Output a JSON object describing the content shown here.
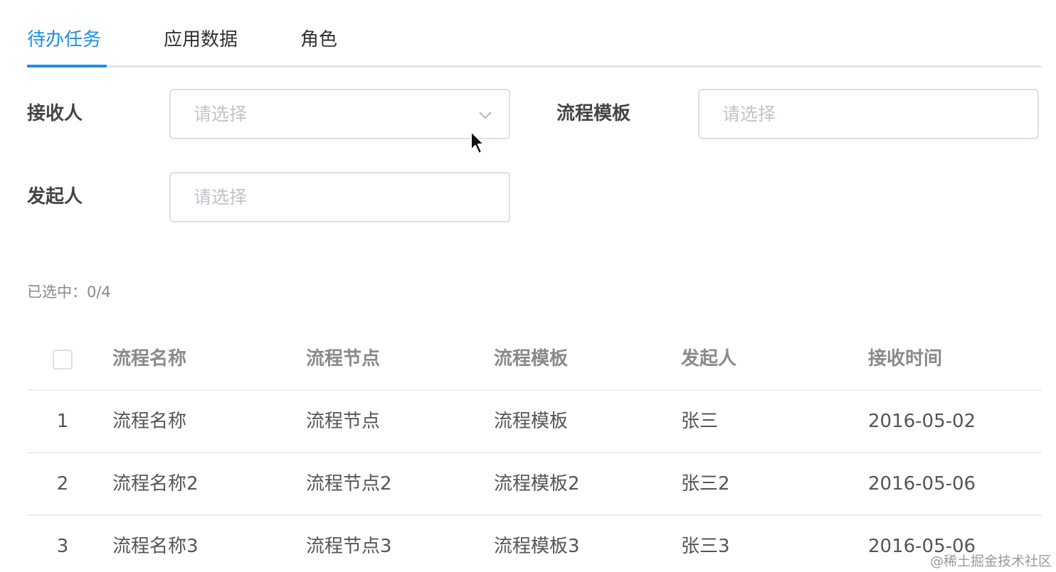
{
  "tabs": [
    {
      "label": "待办任务",
      "active": true
    },
    {
      "label": "应用数据",
      "active": false
    },
    {
      "label": "角色",
      "active": false
    }
  ],
  "accent_color": "#1c8fe6",
  "form": {
    "receiver": {
      "label": "接收人",
      "placeholder": "请选择",
      "icon": "chevron-down-icon"
    },
    "template": {
      "label": "流程模板",
      "placeholder": "请选择"
    },
    "initiator": {
      "label": "发起人",
      "placeholder": "请选择"
    }
  },
  "selection": {
    "text": "已选中：0/4"
  },
  "table": {
    "columns": [
      "流程名称",
      "流程节点",
      "流程模板",
      "发起人",
      "接收时间"
    ],
    "rows": [
      {
        "index": "1",
        "name": "流程名称",
        "node": "流程节点",
        "template": "流程模板",
        "initiator": "张三",
        "time": "2016-05-02"
      },
      {
        "index": "2",
        "name": "流程名称2",
        "node": "流程节点2",
        "template": "流程模板2",
        "initiator": "张三2",
        "time": "2016-05-06"
      },
      {
        "index": "3",
        "name": "流程名称3",
        "node": "流程节点3",
        "template": "流程模板3",
        "initiator": "张三3",
        "time": "2016-05-06"
      }
    ]
  },
  "watermark": "@稀土掘金技术社区"
}
